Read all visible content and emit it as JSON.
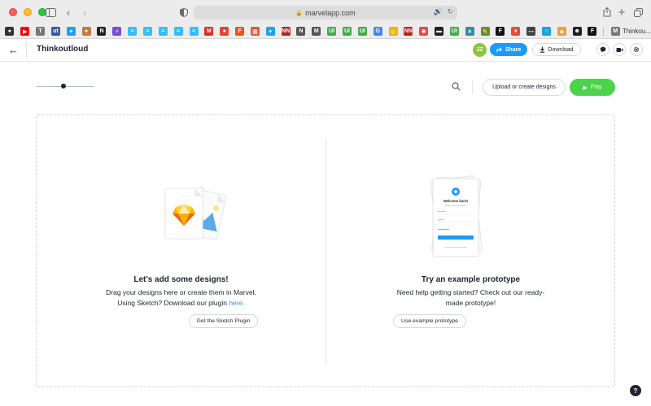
{
  "browser": {
    "url": "marvelapp.com",
    "last_bookmark_label": "Thinkou..."
  },
  "bookmarks": [
    {
      "name": "bookmark-1",
      "color": "#333333",
      "glyph": "●"
    },
    {
      "name": "bookmark-youtube",
      "color": "#ff0000",
      "glyph": "▶"
    },
    {
      "name": "bookmark-t",
      "color": "#777777",
      "glyph": "T"
    },
    {
      "name": "bookmark-ut",
      "color": "#3b5998",
      "glyph": "ut"
    },
    {
      "name": "bookmark-twitter",
      "color": "#1da1f2",
      "glyph": "✦"
    },
    {
      "name": "bookmark-figure",
      "color": "#c27b39",
      "glyph": "●"
    },
    {
      "name": "bookmark-notion",
      "color": "#222222",
      "glyph": "N"
    },
    {
      "name": "bookmark-bolt",
      "color": "#7b4bd6",
      "glyph": "⚡"
    },
    {
      "name": "bookmark-tailwind-1",
      "color": "#38bdf8",
      "glyph": "≈"
    },
    {
      "name": "bookmark-tailwind-2",
      "color": "#38bdf8",
      "glyph": "≈"
    },
    {
      "name": "bookmark-tailwind-3",
      "color": "#38bdf8",
      "glyph": "≈"
    },
    {
      "name": "bookmark-tailwind-4",
      "color": "#38bdf8",
      "glyph": "≈"
    },
    {
      "name": "bookmark-tailwind-5",
      "color": "#38bdf8",
      "glyph": "≈"
    },
    {
      "name": "bookmark-gmail",
      "color": "#d93025",
      "glyph": "M"
    },
    {
      "name": "bookmark-red",
      "color": "#e2442f",
      "glyph": "●"
    },
    {
      "name": "bookmark-figma",
      "color": "#f24e1e",
      "glyph": "F"
    },
    {
      "name": "bookmark-grid",
      "color": "#e05a3a",
      "glyph": "▦"
    },
    {
      "name": "bookmark-twitter-2",
      "color": "#1da1f2",
      "glyph": "✦"
    },
    {
      "name": "bookmark-nn-1",
      "color": "#b3261e",
      "glyph": "NN"
    },
    {
      "name": "bookmark-n",
      "color": "#555555",
      "glyph": "N"
    },
    {
      "name": "bookmark-m",
      "color": "#555555",
      "glyph": "M"
    },
    {
      "name": "bookmark-ui-1",
      "color": "#3fae49",
      "glyph": "UI"
    },
    {
      "name": "bookmark-ui-2",
      "color": "#3fae49",
      "glyph": "UI"
    },
    {
      "name": "bookmark-ui-3",
      "color": "#3fae49",
      "glyph": "UI"
    },
    {
      "name": "bookmark-google",
      "color": "#4285f4",
      "glyph": "G"
    },
    {
      "name": "bookmark-circle",
      "color": "#f0b400",
      "glyph": "◎"
    },
    {
      "name": "bookmark-nn-2",
      "color": "#b3261e",
      "glyph": "NN"
    },
    {
      "name": "bookmark-pinwheel",
      "color": "#e54b4b",
      "glyph": "✺"
    },
    {
      "name": "bookmark-dark-1",
      "color": "#222222",
      "glyph": "▬"
    },
    {
      "name": "bookmark-ui-4",
      "color": "#3fae49",
      "glyph": "UI"
    },
    {
      "name": "bookmark-teal",
      "color": "#2f8f9d",
      "glyph": "▲"
    },
    {
      "name": "bookmark-feather",
      "color": "#6b8e23",
      "glyph": "✎"
    },
    {
      "name": "bookmark-framer",
      "color": "#111111",
      "glyph": "F"
    },
    {
      "name": "bookmark-flame",
      "color": "#e94b3c",
      "glyph": "♦"
    },
    {
      "name": "bookmark-dots",
      "color": "#444444",
      "glyph": "⋯"
    },
    {
      "name": "bookmark-ring",
      "color": "#1fa3d6",
      "glyph": "○"
    },
    {
      "name": "bookmark-diamond",
      "color": "#f29d38",
      "glyph": "◆"
    },
    {
      "name": "bookmark-skull",
      "color": "#222222",
      "glyph": "☻"
    },
    {
      "name": "bookmark-framer-2",
      "color": "#111111",
      "glyph": "F"
    }
  ],
  "app": {
    "project_title": "Thinkoutloud",
    "avatar_initials": "JZ",
    "share_label": "Share",
    "download_label": "Download"
  },
  "toolbar": {
    "zoom_level": 0.47,
    "upload_label": "Upload or create designs",
    "play_label": "Play"
  },
  "left_panel": {
    "heading": "Let's add some designs!",
    "line1": "Drag your designs here or create them in Marvel.",
    "line2_prefix": "Using Sketch? Download our plugin ",
    "line2_link": "here.",
    "cta_label": "Get the Sketch Plugin"
  },
  "right_panel": {
    "heading": "Try an example prototype",
    "line1": "Need help getting started? Check out our ready-",
    "line2": "made prototype!",
    "cta_label": "Use example prototype",
    "phone_title": "Welcome back!",
    "phone_subtitle": "Please sign in to continue"
  },
  "colors": {
    "accent_blue": "#1a9bfc",
    "play_green": "#4cd34c",
    "avatar_green": "#8dc63f",
    "text_dark": "#1f2430"
  }
}
